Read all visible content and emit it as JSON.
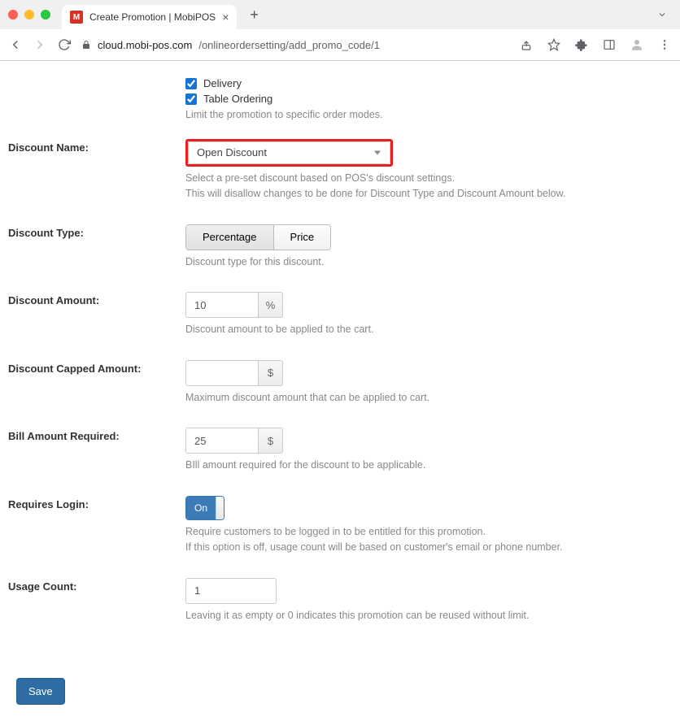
{
  "browser": {
    "tab_title": "Create Promotion | MobiPOS",
    "favicon_letter": "M",
    "url_host": "cloud.mobi-pos.com",
    "url_path": "/onlineordersetting/add_promo_code/1"
  },
  "order_modes": {
    "delivery_label": "Delivery",
    "delivery_checked": true,
    "table_ordering_label": "Table Ordering",
    "table_ordering_checked": true,
    "help": "Limit the promotion to specific order modes."
  },
  "discount_name": {
    "label": "Discount Name:",
    "value": "Open Discount",
    "help1": "Select a pre-set discount based on POS's discount settings.",
    "help2": "This will disallow changes to be done for Discount Type and Discount Amount below."
  },
  "discount_type": {
    "label": "Discount Type:",
    "opt_percentage": "Percentage",
    "opt_price": "Price",
    "help": "Discount type for this discount."
  },
  "discount_amount": {
    "label": "Discount Amount:",
    "value": "10",
    "suffix": "%",
    "help": "Discount amount to be applied to the cart."
  },
  "discount_capped": {
    "label": "Discount Capped Amount:",
    "value": "",
    "suffix": "$",
    "help": "Maximum discount amount that can be applied to cart."
  },
  "bill_required": {
    "label": "Bill Amount Required:",
    "value": "25",
    "suffix": "$",
    "help": "BIll amount required for the discount to be applicable."
  },
  "requires_login": {
    "label": "Requires Login:",
    "toggle_on_label": "On",
    "help1": "Require customers to be logged in to be entitled for this promotion.",
    "help2": "If this option is off, usage count will be based on customer's email or phone number."
  },
  "usage_count": {
    "label": "Usage Count:",
    "value": "1",
    "help": "Leaving it as empty or 0 indicates this promotion can be reused without limit."
  },
  "save_label": "Save"
}
